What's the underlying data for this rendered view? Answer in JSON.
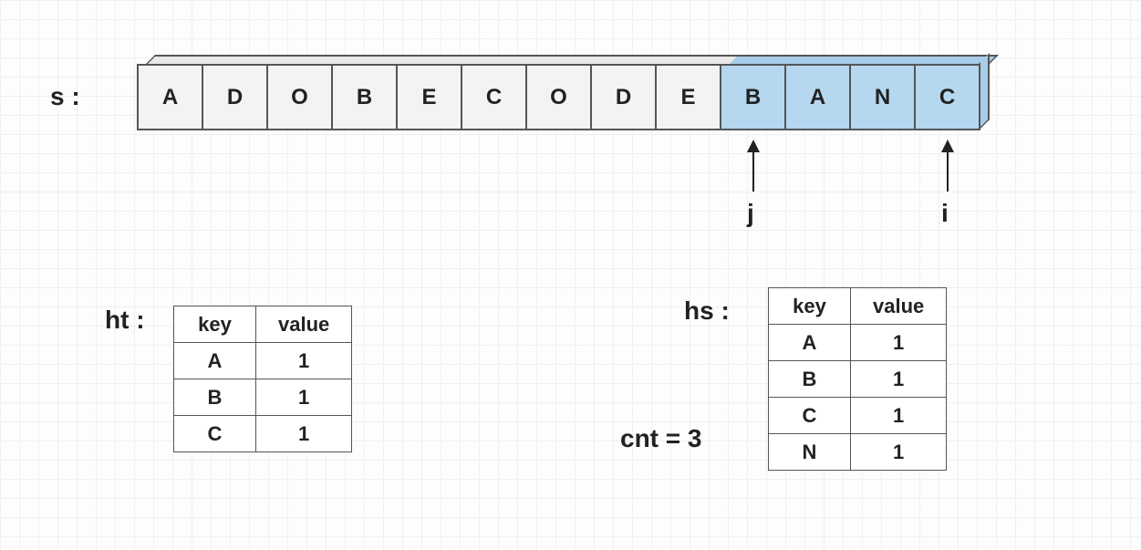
{
  "labels": {
    "s": "s :",
    "ht": "ht :",
    "hs": "hs :",
    "j": "j",
    "i": "i",
    "cnt": "cnt = 3"
  },
  "array": {
    "cells": [
      "A",
      "D",
      "O",
      "B",
      "E",
      "C",
      "O",
      "D",
      "E",
      "B",
      "A",
      "N",
      "C"
    ],
    "highlight_start": 9,
    "highlight_end": 12,
    "j_index": 9,
    "i_index": 12
  },
  "table_ht": {
    "headers": {
      "key": "key",
      "value": "value"
    },
    "rows": [
      {
        "key": "A",
        "value": "1"
      },
      {
        "key": "B",
        "value": "1"
      },
      {
        "key": "C",
        "value": "1"
      }
    ]
  },
  "table_hs": {
    "headers": {
      "key": "key",
      "value": "value"
    },
    "rows": [
      {
        "key": "A",
        "value": "1"
      },
      {
        "key": "B",
        "value": "1"
      },
      {
        "key": "C",
        "value": "1"
      },
      {
        "key": "N",
        "value": "1"
      }
    ]
  },
  "chart_data": {
    "type": "table",
    "description": "Sliding window diagram over string s = ADOBECODEBANC. Window [j=9,i=12] = BANC highlighted. ht is target character counts, hs is current window counts, cnt=3 matched characters.",
    "s": "ADOBECODEBANC",
    "window": {
      "j": 9,
      "i": 12,
      "substring": "BANC"
    },
    "ht": {
      "A": 1,
      "B": 1,
      "C": 1
    },
    "hs": {
      "A": 1,
      "B": 1,
      "C": 1,
      "N": 1
    },
    "cnt": 3
  }
}
